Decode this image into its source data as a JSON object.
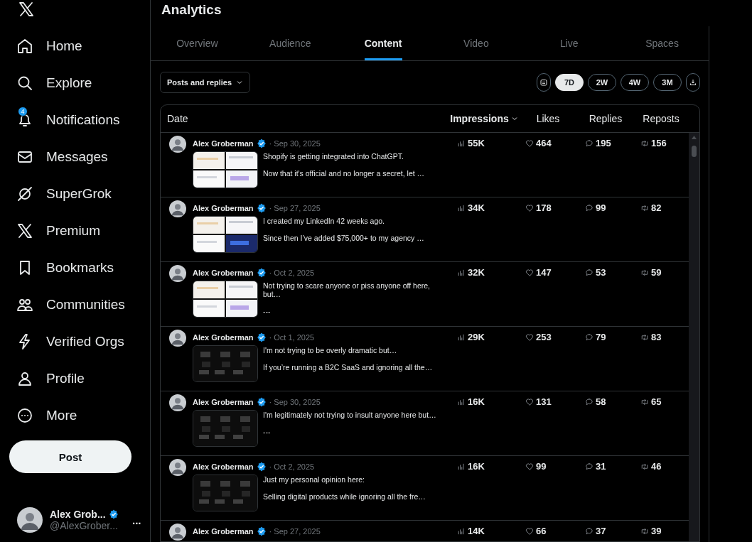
{
  "sidebar": {
    "items": [
      {
        "label": "Home"
      },
      {
        "label": "Explore"
      },
      {
        "label": "Notifications",
        "badge": "4"
      },
      {
        "label": "Messages"
      },
      {
        "label": "SuperGrok"
      },
      {
        "label": "Premium"
      },
      {
        "label": "Bookmarks"
      },
      {
        "label": "Communities"
      },
      {
        "label": "Verified Orgs"
      },
      {
        "label": "Profile"
      },
      {
        "label": "More"
      }
    ],
    "post_button": "Post",
    "account": {
      "name": "Alex Grob...",
      "verified": true,
      "handle": "@AlexGrober...",
      "more": "..."
    }
  },
  "page": {
    "title": "Analytics"
  },
  "tabs": [
    {
      "label": "Overview",
      "selected": false
    },
    {
      "label": "Audience",
      "selected": false
    },
    {
      "label": "Content",
      "selected": true
    },
    {
      "label": "Video",
      "selected": false
    },
    {
      "label": "Live",
      "selected": false
    },
    {
      "label": "Spaces",
      "selected": false
    }
  ],
  "filter": {
    "label": "Posts and replies"
  },
  "ranges": [
    {
      "label": "7D",
      "selected": true
    },
    {
      "label": "2W",
      "selected": false
    },
    {
      "label": "4W",
      "selected": false
    },
    {
      "label": "3M",
      "selected": false
    }
  ],
  "table": {
    "columns": [
      {
        "label": "Date",
        "sorted": false
      },
      {
        "label": "Impressions",
        "sorted": true
      },
      {
        "label": "Likes",
        "sorted": false
      },
      {
        "label": "Replies",
        "sorted": false
      },
      {
        "label": "Reposts",
        "sorted": false
      }
    ],
    "rows": [
      {
        "author": "Alex Groberman",
        "verified": true,
        "date": "· Sep 30, 2025",
        "text": [
          "Shopify is getting integrated into ChatGPT.",
          "Now that it's official and no longer a secret, let …"
        ],
        "impressions": "55K",
        "likes": "464",
        "replies": "195",
        "reposts": "156"
      },
      {
        "author": "Alex Groberman",
        "verified": true,
        "date": "· Sep 27, 2025",
        "text": [
          "I created my LinkedIn 42 weeks ago.",
          "Since then I’ve added $75,000+ to my agency …"
        ],
        "impressions": "34K",
        "likes": "178",
        "replies": "99",
        "reposts": "82"
      },
      {
        "author": "Alex Groberman",
        "verified": true,
        "date": "· Oct 2, 2025",
        "text": [
          "Not trying to scare anyone or piss anyone off here, but…",
          "---"
        ],
        "impressions": "32K",
        "likes": "147",
        "replies": "53",
        "reposts": "59"
      },
      {
        "author": "Alex Groberman",
        "verified": true,
        "date": "· Oct 1, 2025",
        "text": [
          "I'm not trying to be overly dramatic but…",
          "If you’re running a B2C SaaS and ignoring all the…"
        ],
        "impressions": "29K",
        "likes": "253",
        "replies": "79",
        "reposts": "83"
      },
      {
        "author": "Alex Groberman",
        "verified": true,
        "date": "· Sep 30, 2025",
        "text": [
          "I'm legitimately not trying to insult anyone here but…",
          "---"
        ],
        "impressions": "16K",
        "likes": "131",
        "replies": "58",
        "reposts": "65"
      },
      {
        "author": "Alex Groberman",
        "verified": true,
        "date": "· Oct 2, 2025",
        "text": [
          "Just my personal opinion here:",
          "Selling digital products while ignoring all the fre…"
        ],
        "impressions": "16K",
        "likes": "99",
        "replies": "31",
        "reposts": "46"
      },
      {
        "author": "Alex Groberman",
        "verified": true,
        "date": "· Sep 27, 2025",
        "impressions": "14K",
        "likes": "66",
        "replies": "37",
        "reposts": "39"
      }
    ]
  }
}
